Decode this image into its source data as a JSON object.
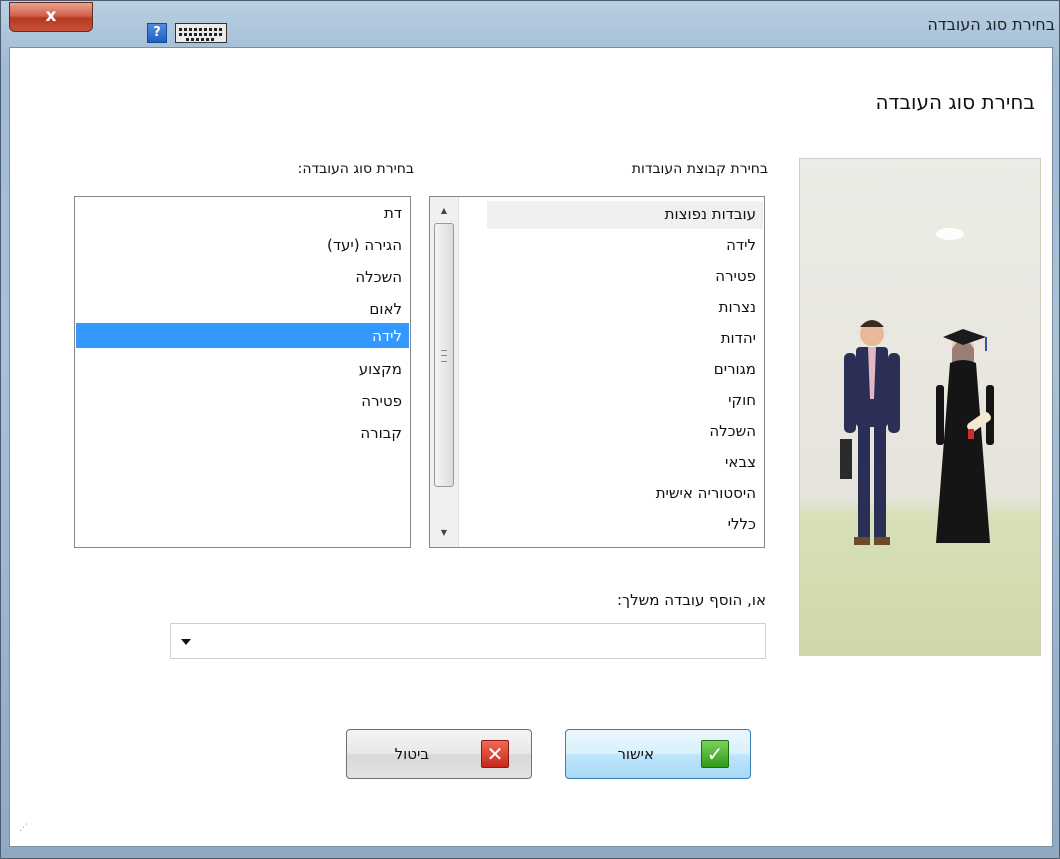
{
  "window": {
    "title": "בחירת סוג העובדה",
    "close_label": "x",
    "help_label": "?"
  },
  "dialog": {
    "heading": "בחירת סוג העובדה"
  },
  "groups_list": {
    "label": "בחירת קבוצת העובדות",
    "items": [
      "עובדות נפוצות",
      "לידה",
      "פטירה",
      "נצרות",
      "יהדות",
      "מגורים",
      "חוקי",
      "השכלה",
      "צבאי",
      "היסטוריה אישית",
      "כללי"
    ],
    "hovered_index": 0
  },
  "types_list": {
    "label": "בחירת סוג העובדה:",
    "items": [
      "דת",
      "הגירה (יעד)",
      "השכלה",
      "לאום",
      "לידה",
      "מקצוע",
      "פטירה",
      "קבורה"
    ],
    "selected_index": 4
  },
  "custom_fact": {
    "label": "או, הוסף עובדה משלך:",
    "value": ""
  },
  "buttons": {
    "ok_label": "אישור",
    "cancel_label": "ביטול"
  },
  "colors": {
    "selection": "#3399ff",
    "ok_icon": "#2f9a1a",
    "cancel_icon": "#c6281b"
  }
}
